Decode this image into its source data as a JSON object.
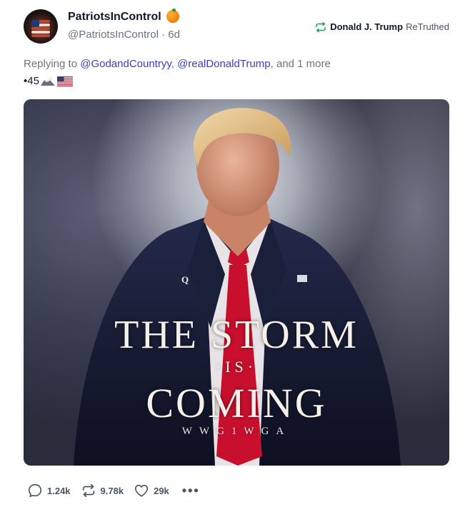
{
  "author": {
    "name": "PatriotsInControl",
    "handle": "@PatriotsInControl",
    "age": "6d",
    "badge_icon": "orange-icon",
    "avatar_icon": "stacked-flag-avatar"
  },
  "retruth": {
    "icon": "retruth-icon",
    "name": "Donald J. Trump",
    "label": "ReTruthed",
    "color": "#16a34a"
  },
  "reply": {
    "prefix": "Replying to ",
    "mention_1": "@GodandCountryy",
    "separator": ", ",
    "mention_2": "@realDonaldTrump",
    "suffix": ", and 1 more",
    "mention_color": "#3b3fb8"
  },
  "post_text": {
    "text": "•45",
    "emoji_1": "eagle-emoji",
    "emoji_2": "us-flag-emoji"
  },
  "media": {
    "line_1": "THE STORM",
    "line_2": "·IS·",
    "line_3": "COMING",
    "line_4": "WWG1WGA",
    "pin_letter": "Q",
    "tie_color": "#c8102e",
    "suit_color": "#1a1f3a"
  },
  "actions": {
    "replies": "1.24k",
    "retruths": "9.78k",
    "likes": "29k",
    "more": "•••"
  }
}
